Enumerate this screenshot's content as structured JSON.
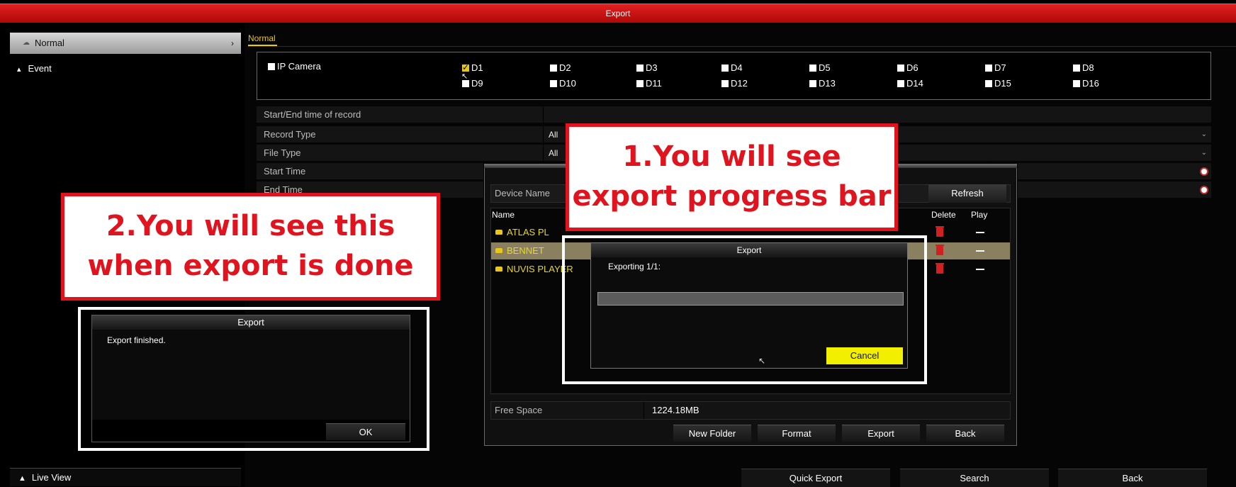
{
  "window": {
    "title": "Export"
  },
  "sidebar": {
    "items": [
      {
        "label": "Normal"
      },
      {
        "label": "Event"
      }
    ],
    "live_view": "Live View"
  },
  "main": {
    "tab": "Normal",
    "cameras": {
      "group_label": "IP Camera",
      "channels": [
        "D1",
        "D2",
        "D3",
        "D4",
        "D5",
        "D6",
        "D7",
        "D8",
        "D9",
        "D10",
        "D11",
        "D12",
        "D13",
        "D14",
        "D15",
        "D16"
      ],
      "checked": [
        "D1"
      ]
    },
    "form": {
      "start_end_label": "Start/End time of record",
      "record_type_label": "Record Type",
      "record_type_value": "All",
      "file_type_label": "File Type",
      "file_type_value": "All",
      "start_time_label": "Start Time",
      "end_time_label": "End Time"
    }
  },
  "device_dialog": {
    "device_name_label": "Device Name",
    "refresh": "Refresh",
    "columns": {
      "name": "Name",
      "delete": "Delete",
      "play": "Play"
    },
    "files": [
      {
        "name": "ATLAS PL"
      },
      {
        "name": "BENNET"
      },
      {
        "name": "NUVIS PLAYER"
      }
    ],
    "free_space_label": "Free Space",
    "free_space_value": "1224.18MB",
    "buttons": {
      "new_folder": "New Folder",
      "format": "Format",
      "export": "Export",
      "back": "Back"
    }
  },
  "progress_dialog": {
    "title": "Export",
    "text": "Exporting 1/1:",
    "progress": 0,
    "cancel": "Cancel"
  },
  "finished_dialog": {
    "title": "Export",
    "text": "Export finished.",
    "ok": "OK"
  },
  "annotations": {
    "callout1": "1.You will see export progress bar",
    "callout2": "2.You will see this when export is done"
  },
  "bottom_bar": {
    "quick_export": "Quick Export",
    "search": "Search",
    "back": "Back"
  },
  "colors": {
    "title_red": "#c81010",
    "accent_yellow": "#e8c61a",
    "callout_red": "#e0141e"
  }
}
